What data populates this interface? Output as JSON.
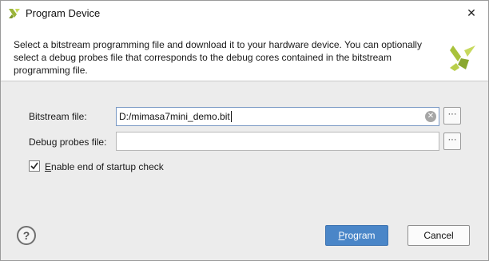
{
  "window": {
    "title": "Program Device",
    "close_glyph": "✕"
  },
  "header": {
    "description": "Select a bitstream programming file and download it to your hardware device. You can optionally select a debug probes file that corresponds to the debug cores contained in the bitstream programming file.",
    "logo_icon": "xilinx-logo-icon"
  },
  "form": {
    "bitstream_label_pre": "Bitstream file:",
    "bitstream_value": "D:/mimasa7mini_demo.bit",
    "bitstream_browse": "···",
    "debug_label_pre": "Debu",
    "debug_label_u": "g",
    "debug_label_post": " probes file:",
    "debug_value": "",
    "debug_browse": "···",
    "startup_check_label_u": "E",
    "startup_check_label_post": "nable end of startup check",
    "startup_check_checked": true
  },
  "footer": {
    "help_glyph": "?",
    "program_label_u": "P",
    "program_label_post": "rogram",
    "cancel_label": "Cancel"
  },
  "colors": {
    "primary_button": "#4a86c8",
    "content_bg": "#ececec",
    "brand_green": "#a8c23a"
  }
}
